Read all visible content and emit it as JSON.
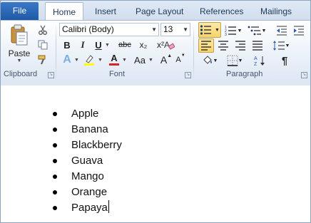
{
  "tabs": {
    "file": "File",
    "home": "Home",
    "insert": "Insert",
    "page_layout": "Page Layout",
    "references": "References",
    "mailings": "Mailings"
  },
  "clipboard": {
    "paste_label": "Paste",
    "group_label": "Clipboard"
  },
  "font": {
    "name": "Calibri (Body)",
    "size": "13",
    "bold": "B",
    "italic": "I",
    "underline": "U",
    "strikethrough": "abc",
    "subscript": "x₂",
    "superscript": "x²",
    "text_effects": "A",
    "font_color": "A",
    "change_case": "Aa",
    "grow": "A",
    "shrink": "A",
    "group_label": "Font",
    "highlight_color": "#ffff00",
    "font_color_value": "#e02020"
  },
  "paragraph": {
    "group_label": "Paragraph",
    "show_marks": "¶"
  },
  "document": {
    "items": [
      "Apple",
      "Banana",
      "Blackberry",
      "Guava",
      "Mango",
      "Orange",
      "Papaya"
    ]
  }
}
